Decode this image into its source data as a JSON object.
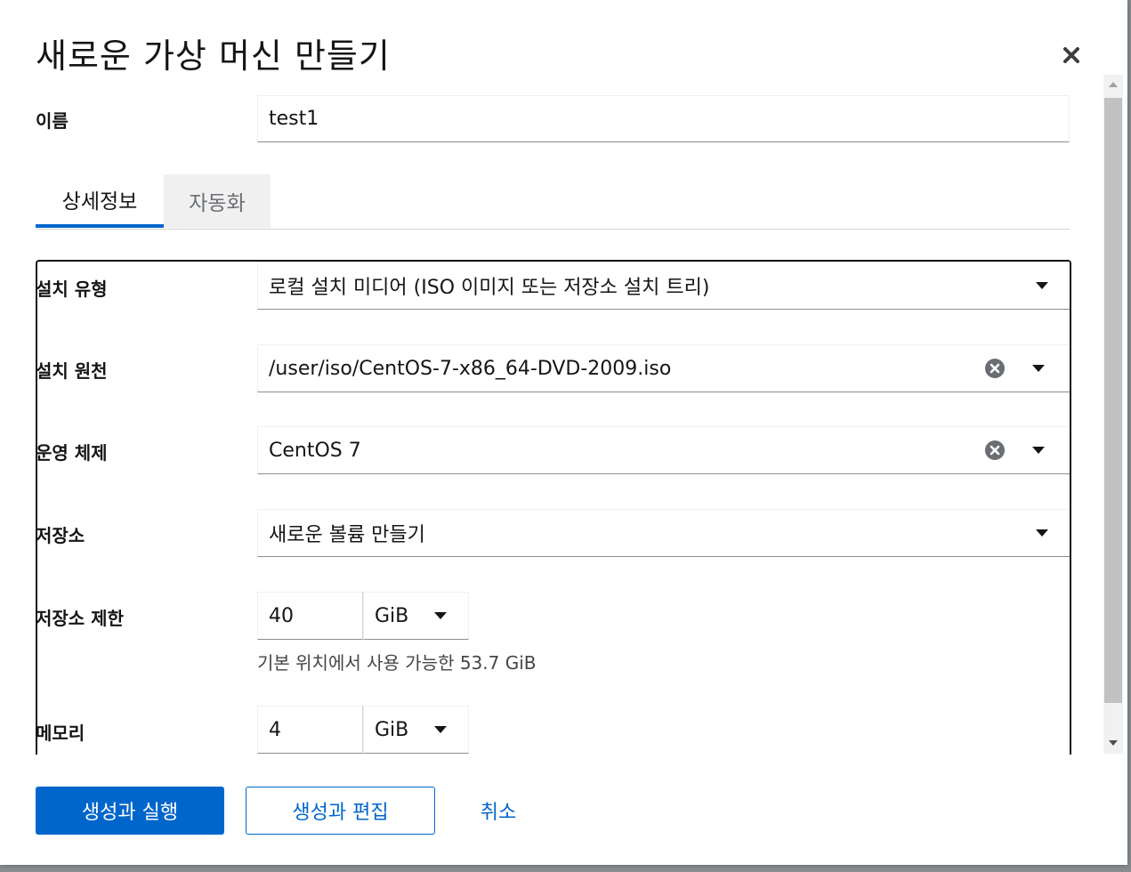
{
  "modal": {
    "title": "새로운 가상 머신 만들기"
  },
  "name_field": {
    "label": "이름",
    "value": "test1"
  },
  "tabs": [
    {
      "label": "상세정보",
      "active": true
    },
    {
      "label": "자동화",
      "active": false
    }
  ],
  "form": {
    "install_type": {
      "label": "설치 유형",
      "value": "로컬 설치 미디어 (ISO 이미지 또는 저장소 설치 트리)"
    },
    "install_source": {
      "label": "설치 원천",
      "value": "/user/iso/CentOS-7-x86_64-DVD-2009.iso"
    },
    "os": {
      "label": "운영 체제",
      "value": "CentOS 7"
    },
    "storage": {
      "label": "저장소",
      "value": "새로운 볼륨 만들기"
    },
    "storage_limit": {
      "label": "저장소 제한",
      "value": "40",
      "unit": "GiB",
      "helper": "기본 위치에서 사용 가능한 53.7 GiB"
    },
    "memory": {
      "label": "메모리",
      "value": "4",
      "unit": "GiB"
    }
  },
  "footer": {
    "create_run_label": "생성과 실행",
    "create_edit_label": "생성과 편집",
    "cancel_label": "취소"
  },
  "colors": {
    "primary": "#0066cc",
    "text": "#151515",
    "border": "#8a8d90"
  }
}
